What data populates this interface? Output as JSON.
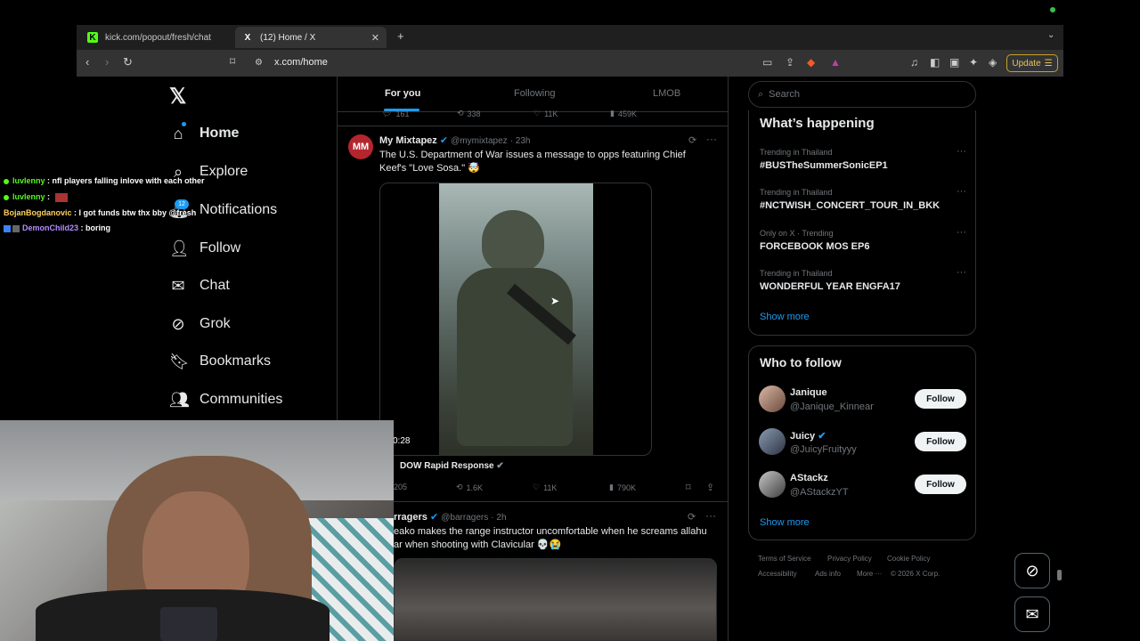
{
  "browser": {
    "tabs": [
      {
        "label": "kick.com/popout/fresh/chat",
        "favicon": "K"
      },
      {
        "label": "(12) Home / X",
        "favicon": "X"
      }
    ],
    "url": "x.com/home",
    "update_label": "Update"
  },
  "nav": {
    "items": [
      {
        "label": "Home",
        "icon": "home-icon"
      },
      {
        "label": "Explore",
        "icon": "search-icon"
      },
      {
        "label": "Notifications",
        "icon": "bell-icon"
      },
      {
        "label": "Follow",
        "icon": "person-add-icon"
      },
      {
        "label": "Chat",
        "icon": "mail-icon"
      },
      {
        "label": "Grok",
        "icon": "grok-icon"
      },
      {
        "label": "Bookmarks",
        "icon": "bookmark-icon"
      },
      {
        "label": "Communities",
        "icon": "people-icon"
      }
    ],
    "notifications_badge": "12"
  },
  "chat_overlay": [
    {
      "user": "luvlenny",
      "text": ": nfl players falling inlove with each other",
      "color": "#53fc18"
    },
    {
      "user": "luvlenny",
      "text": ":",
      "color": "#53fc18"
    },
    {
      "user": "BojanBogdanovic",
      "text": ": I got funds btw thx bby @fresh",
      "color": "#ffd15c"
    },
    {
      "user": "DemonChild23",
      "text": ": boring",
      "color": "#b48cff"
    }
  ],
  "feed": {
    "tabs": [
      "For you",
      "Following",
      "LMOB"
    ],
    "prev_stats": [
      "161",
      "338",
      "11K",
      "459K"
    ],
    "post1": {
      "author": "My Mixtapez",
      "handle": "@mymixtapez",
      "time": "· 23h",
      "text": "The U.S. Department of War issues a message to opps featuring Chief Keef's \"Love Sosa.\" 🤯",
      "duration": "0:28",
      "source": "DOW Rapid Response",
      "replies": "205",
      "reposts": "1.6K",
      "likes": "11K",
      "views": "790K"
    },
    "post2": {
      "author": "rragers",
      "handle": "@barragers",
      "time": "· 2h",
      "text": "eako makes the range instructor uncomfortable when he screams allahu",
      "text2": "ar when shooting with Clavicular 💀😭"
    }
  },
  "right": {
    "search_placeholder": "Search",
    "whats_happening": "What’s happening",
    "trends": [
      {
        "context": "Trending in Thailand",
        "name": "#BUSTheSummerSonicEP1"
      },
      {
        "context": "Trending in Thailand",
        "name": "#NCTWISH_CONCERT_TOUR_IN_BKK"
      },
      {
        "context": "Only on X · Trending",
        "name": "FORCEBOOK MOS EP6"
      },
      {
        "context": "Trending in Thailand",
        "name": "WONDERFUL YEAR ENGFA17"
      }
    ],
    "show_more": "Show more",
    "who_to_follow": "Who to follow",
    "follow_suggestions": [
      {
        "name": "Janique",
        "handle": "@Janique_Kinnear",
        "verified": false
      },
      {
        "name": "Juicy",
        "handle": "@JuicyFruityyy",
        "verified": true
      },
      {
        "name": "AStackz",
        "handle": "@AStackzYT",
        "verified": false
      }
    ],
    "follow_label": "Follow",
    "footer": [
      "Terms of Service",
      "Privacy Policy",
      "Cookie Policy",
      "Accessibility",
      "Ads info",
      "More ···",
      "© 2026 X Corp."
    ]
  },
  "colors": {
    "accent": "#1d9bf0",
    "kick_green": "#53fc18"
  }
}
